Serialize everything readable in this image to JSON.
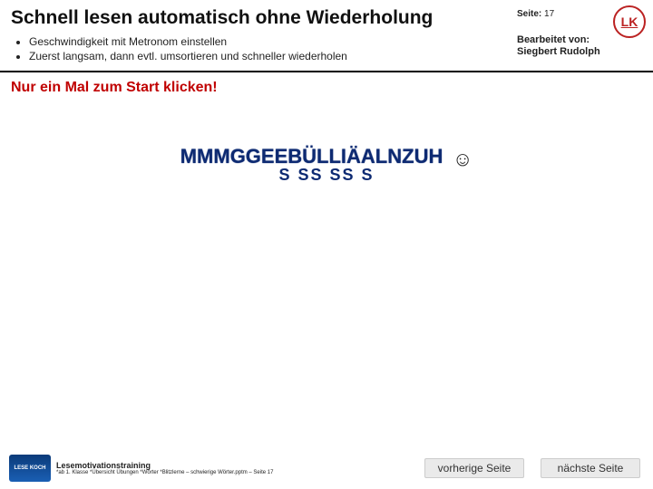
{
  "header": {
    "title": "Schnell lesen automatisch ohne Wiederholung",
    "page_label": "Seite:",
    "page_number": "17",
    "edited_label": "Bearbeitet von:",
    "edited_by": "Siegbert Rudolph",
    "logo_glyph": "LK"
  },
  "bullets": [
    "Geschwindigkeit mit Metronom einstellen",
    "Zuerst langsam, dann evtl. umsortieren und schneller wiederholen"
  ],
  "start_hint": "Nur ein Mal zum Start klicken!",
  "center": {
    "overlay_line1": "MMMGGEEBÜLLIÄALNZUH",
    "overlay_line2": "S SS SS   S",
    "smiley": "☺"
  },
  "footer": {
    "brand_logo_text": "LESE KOCH",
    "line1": "Lesemotivationstraining",
    "line2": "*ab 1. Klasse *Übersicht  Übungen *Wörter *Blitzlerne – schwierige Wörter.pptm – Seite 17"
  },
  "nav": {
    "prev": "vorherige Seite",
    "next": "nächste Seite"
  }
}
